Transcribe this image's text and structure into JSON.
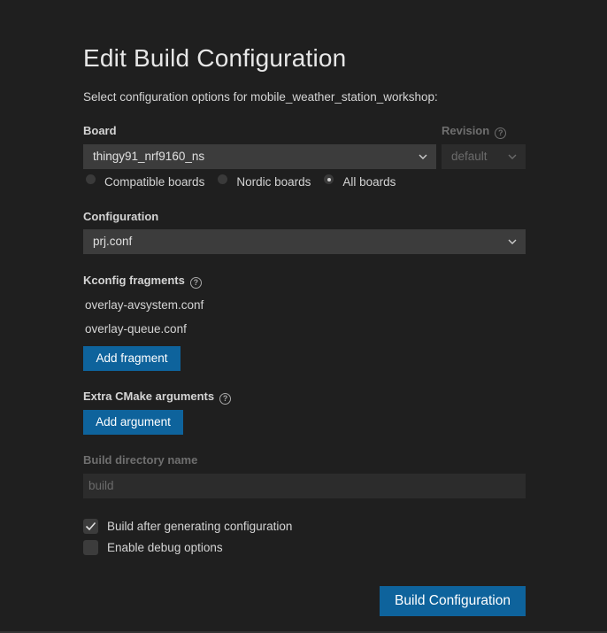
{
  "title": "Edit Build Configuration",
  "subtitle": "Select configuration options for mobile_weather_station_workshop:",
  "board": {
    "label": "Board",
    "value": "thingy91_nrf9160_ns",
    "revision_label": "Revision",
    "revision_value": "default",
    "filters": [
      {
        "label": "Compatible boards",
        "checked": false
      },
      {
        "label": "Nordic boards",
        "checked": false
      },
      {
        "label": "All boards",
        "checked": true
      }
    ]
  },
  "configuration": {
    "label": "Configuration",
    "value": "prj.conf"
  },
  "kconfig": {
    "label": "Kconfig fragments",
    "items": [
      "overlay-avsystem.conf",
      "overlay-queue.conf"
    ],
    "add_label": "Add fragment"
  },
  "cmake": {
    "label": "Extra CMake arguments",
    "add_label": "Add argument"
  },
  "build_dir": {
    "label": "Build directory name",
    "placeholder": "build"
  },
  "options": {
    "build_after": {
      "label": "Build after generating configuration",
      "checked": true
    },
    "debug": {
      "label": "Enable debug options",
      "checked": false
    }
  },
  "submit_label": "Build Configuration",
  "icons": {
    "help": "help-circle-icon",
    "chevron": "chevron-down-icon",
    "check": "checkmark-icon"
  },
  "colors": {
    "accent": "#0e639c",
    "background": "#1f1f1f"
  }
}
